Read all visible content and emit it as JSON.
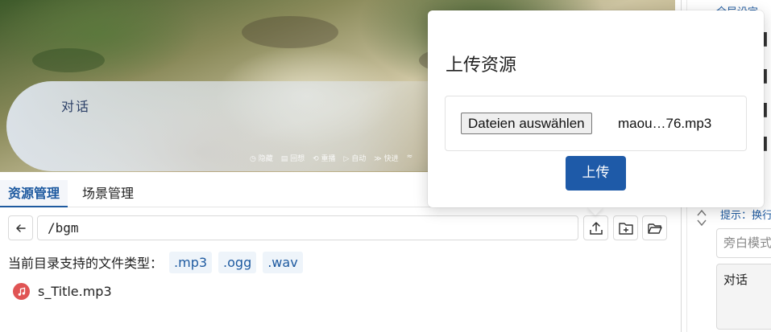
{
  "preview": {
    "dialog_name": "对话",
    "controls": [
      "◷ 隐藏",
      "▤ 回想",
      "⟲ 重播",
      "▷ 自动",
      "≫ 快进",
      "≈"
    ]
  },
  "tabs": [
    {
      "label": "资源管理",
      "active": true
    },
    {
      "label": "场景管理",
      "active": false
    }
  ],
  "explorer": {
    "path": "/bgm",
    "supported_label": "当前目录支持的文件类型：",
    "file_types": [
      ".mp3",
      ".ogg",
      ".wav"
    ],
    "files": [
      {
        "name": "s_Title.mp3",
        "icon": "music-note-icon"
      }
    ]
  },
  "sidebar": {
    "top_link": "全局设定",
    "hint": "提示：换行",
    "narration_placeholder": "旁白模式",
    "dialog_text": "对话"
  },
  "upload_popover": {
    "title": "上传资源",
    "choose_button": "Dateien auswählen",
    "chosen_file": "maou…76.mp3",
    "upload_button": "上传"
  },
  "colors": {
    "accent": "#1e5aa0",
    "upload_button": "#1e5aa8",
    "music_icon": "#e05454"
  }
}
